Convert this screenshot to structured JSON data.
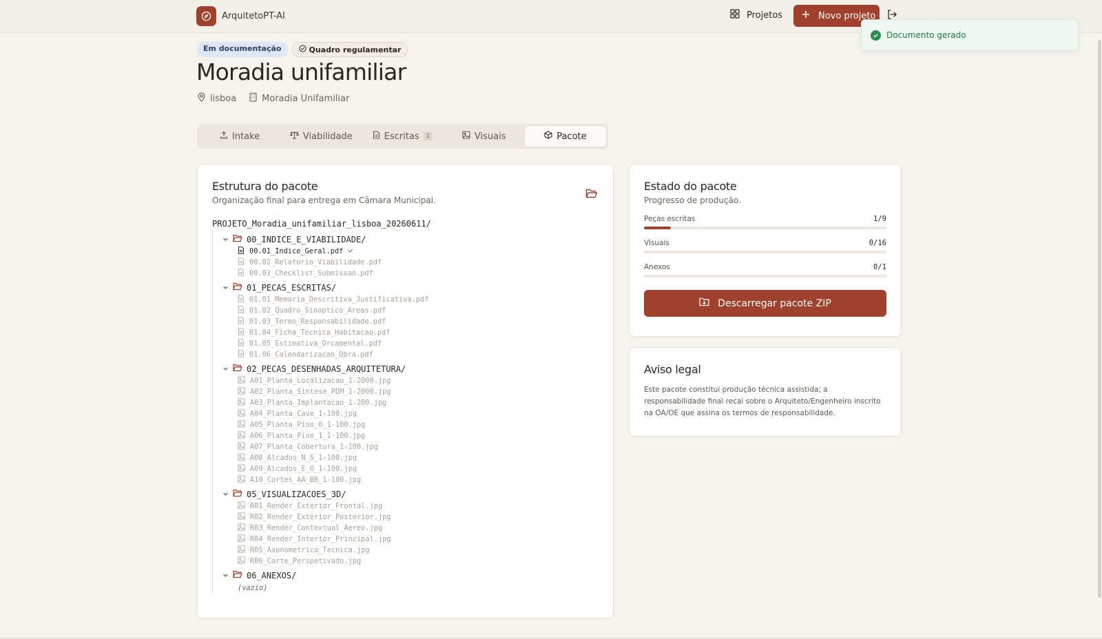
{
  "header": {
    "brand": "ArquitetoPT-AI",
    "nav_projects": "Projetos",
    "new_project": "Novo projeto"
  },
  "toast": {
    "message": "Documento gerado"
  },
  "project": {
    "badge_status": "Em documentação",
    "badge_regulation": "Quadro regulamentar",
    "title": "Moradia unifamiliar",
    "location": "lisboa",
    "type": "Moradia Unifamiliar"
  },
  "tabs": [
    {
      "label": "Intake"
    },
    {
      "label": "Viabilidade"
    },
    {
      "label": "Escritas",
      "count": "1"
    },
    {
      "label": "Visuais"
    },
    {
      "label": "Pacote",
      "active": true
    }
  ],
  "structure": {
    "title": "Estrutura do pacote",
    "subtitle": "Organização final para entrega em Câmara Municipal.",
    "root": "PROJETO_Moradia_unifamiliar_lisboa_20260611/",
    "folders": [
      {
        "name": "00_INDICE_E_VIABILIDADE/",
        "files": [
          {
            "name": "00.01_Indice_Geral.pdf",
            "type": "doc",
            "done": true
          },
          {
            "name": "00.02_Relatorio_Viabilidade.pdf",
            "type": "doc"
          },
          {
            "name": "00.03_Checklist_Submissao.pdf",
            "type": "doc"
          }
        ]
      },
      {
        "name": "01_PECAS_ESCRITAS/",
        "files": [
          {
            "name": "01.01_Memoria_Descritiva_Justificativa.pdf",
            "type": "doc"
          },
          {
            "name": "01.02_Quadro_Sinoptico_Areas.pdf",
            "type": "doc"
          },
          {
            "name": "01.03_Termo_Responsabilidade.pdf",
            "type": "doc"
          },
          {
            "name": "01.04_Ficha_Tecnica_Habitacao.pdf",
            "type": "doc"
          },
          {
            "name": "01.05_Estimativa_Orcamental.pdf",
            "type": "doc"
          },
          {
            "name": "01.06_Calendarizacao_Obra.pdf",
            "type": "doc"
          }
        ]
      },
      {
        "name": "02_PECAS_DESENHADAS_ARQUITETURA/",
        "files": [
          {
            "name": "A01_Planta_Localizacao_1-2000.jpg",
            "type": "img"
          },
          {
            "name": "A02_Planta_Sintese_PDM_1-2000.jpg",
            "type": "img"
          },
          {
            "name": "A03_Planta_Implantacao_1-200.jpg",
            "type": "img"
          },
          {
            "name": "A04_Planta_Cave_1-100.jpg",
            "type": "img"
          },
          {
            "name": "A05_Planta_Piso_0_1-100.jpg",
            "type": "img"
          },
          {
            "name": "A06_Planta_Piso_1_1-100.jpg",
            "type": "img"
          },
          {
            "name": "A07_Planta_Cobertura_1-100.jpg",
            "type": "img"
          },
          {
            "name": "A08_Alcados_N_S_1-100.jpg",
            "type": "img"
          },
          {
            "name": "A09_Alcados_E_O_1-100.jpg",
            "type": "img"
          },
          {
            "name": "A10_Cortes_AA_BB_1-100.jpg",
            "type": "img"
          }
        ]
      },
      {
        "name": "05_VISUALIZACOES_3D/",
        "files": [
          {
            "name": "R01_Render_Exterior_Frontal.jpg",
            "type": "img"
          },
          {
            "name": "R02_Render_Exterior_Posterior.jpg",
            "type": "img"
          },
          {
            "name": "R03_Render_Contextual_Aereo.jpg",
            "type": "img"
          },
          {
            "name": "R04_Render_Interior_Principal.jpg",
            "type": "img"
          },
          {
            "name": "R05_Axonometrica_Tecnica.jpg",
            "type": "img"
          },
          {
            "name": "R06_Corte_Perspetivado.jpg",
            "type": "img"
          }
        ]
      },
      {
        "name": "06_ANEXOS/",
        "files": [],
        "empty_label": "(vazio)"
      }
    ]
  },
  "estado": {
    "title": "Estado do pacote",
    "subtitle": "Progresso de produção.",
    "progress": [
      {
        "label": "Peças escritas",
        "value": "1/9",
        "fraction": 0.111
      },
      {
        "label": "Visuais",
        "value": "0/16",
        "fraction": 0
      },
      {
        "label": "Anexos",
        "value": "0/1",
        "fraction": 0
      }
    ],
    "download_button": "Descarregar pacote ZIP"
  },
  "aviso": {
    "title": "Aviso legal",
    "text": "Este pacote constitui produção técnica assistida; a responsabilidade final recai sobre o Arquiteto/Engenheiro inscrito na OA/OE que assina os termos de responsabilidade."
  },
  "colors": {
    "accent": "#a0412d",
    "background": "#f6f3ee",
    "toast_text": "#217a44"
  }
}
